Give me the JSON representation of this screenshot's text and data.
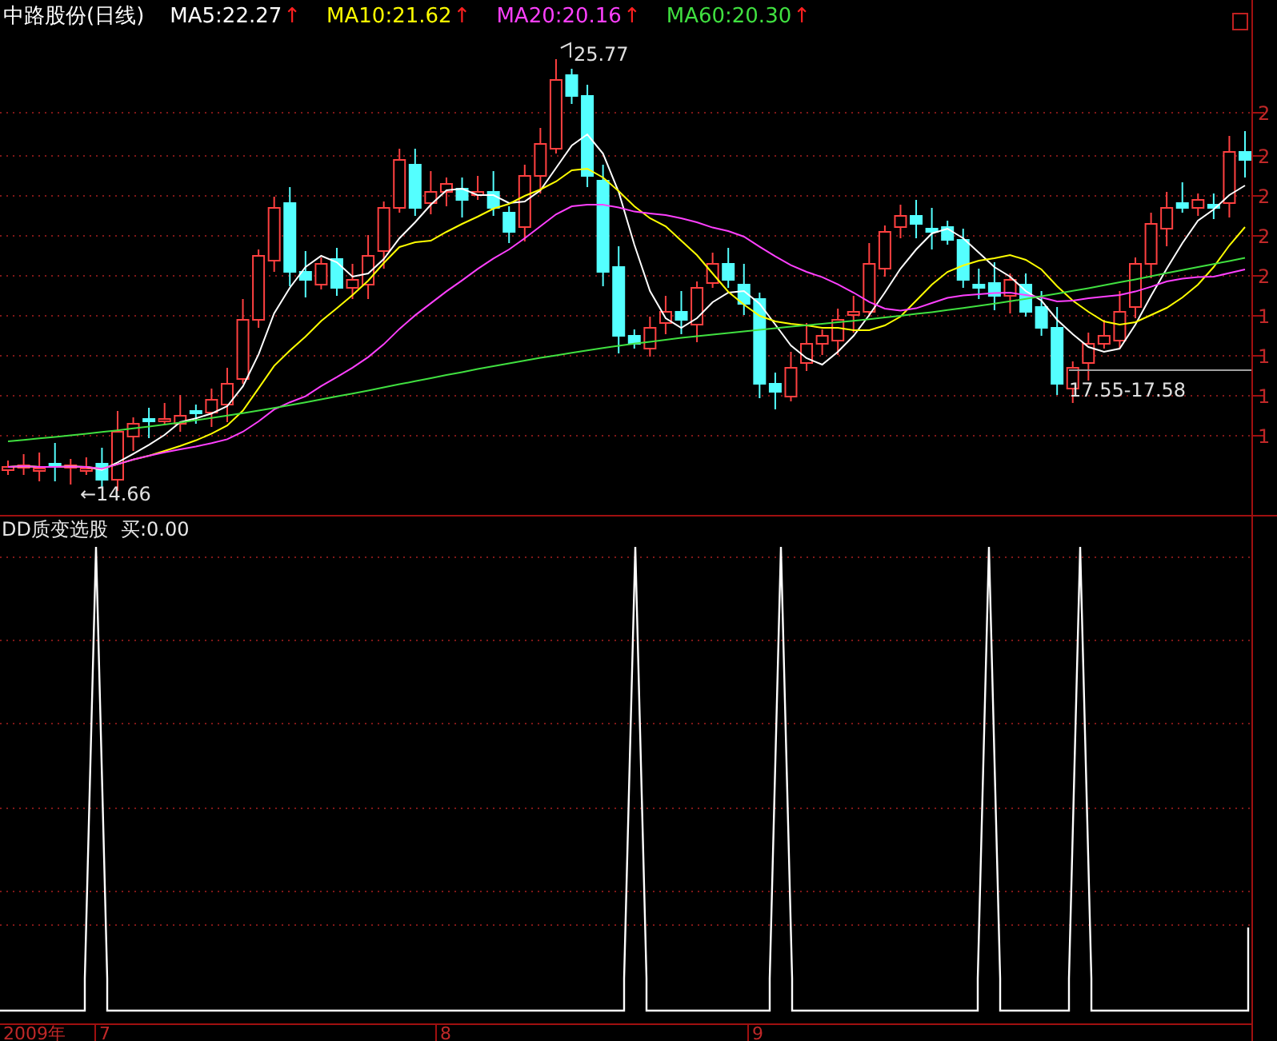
{
  "legend": {
    "title": "中路股份(日线)",
    "averages": [
      {
        "label": "MA5:22.27",
        "color": "#ffffff",
        "arrow": "↑"
      },
      {
        "label": "MA10:21.62",
        "color": "#ffff00",
        "arrow": "↑"
      },
      {
        "label": "MA20:20.16",
        "color": "#ff40ff",
        "arrow": "↑"
      },
      {
        "label": "MA60:20.30",
        "color": "#40e040",
        "arrow": "↑"
      }
    ]
  },
  "annotations": {
    "high": "25.77",
    "low": "←14.66",
    "range": "17.55-17.58"
  },
  "price_axis": {
    "labels": [
      "2",
      "2",
      "2",
      "2",
      "2",
      "1",
      "1",
      "1",
      "1"
    ]
  },
  "indicator": {
    "title": "DD质变选股",
    "reading": "买:0.00"
  },
  "time_axis": {
    "labels": [
      "2009年",
      "7",
      "8",
      "9"
    ]
  }
}
